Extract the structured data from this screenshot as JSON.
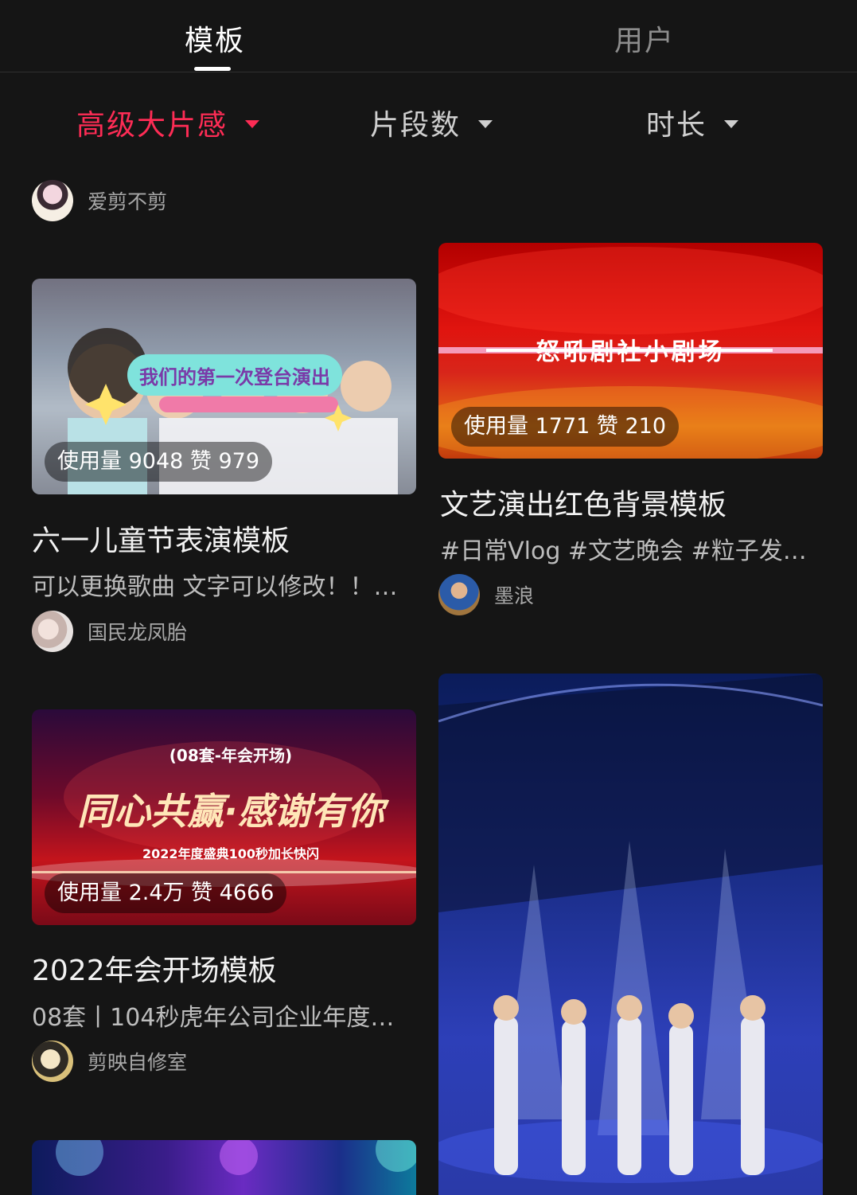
{
  "tabs": [
    {
      "label": "模板",
      "active": true
    },
    {
      "label": "用户",
      "active": false
    }
  ],
  "filters": [
    {
      "label": "高级大片感",
      "active": true
    },
    {
      "label": "片段数",
      "active": false
    },
    {
      "label": "时长",
      "active": false
    }
  ],
  "colors": {
    "accent": "#fe2c55",
    "background": "#151515"
  },
  "cards": [
    {
      "author": "爱剪不剪"
    },
    {
      "author": "墨浪"
    },
    {
      "thumb_caption": "我们的第一次登台演出",
      "stats": "使用量 9048 赞 979",
      "title": "六一儿童节表演模板",
      "description": "可以更换歌曲 文字可以修改！！…",
      "author": "国民龙凤胎"
    },
    {
      "thumb_caption": "怒吼剧社小剧场",
      "stats": "使用量 1771 赞 210",
      "title": "文艺演出红色背景模板",
      "description": "#日常Vlog #文艺晚会 #粒子发…",
      "author": "墨浪"
    },
    {
      "thumb_caption_top": "(08套-年会开场)",
      "thumb_caption": "同心共赢·感谢有你",
      "thumb_caption_sub": "2022年度盛典100秒加长快闪",
      "stats": "使用量 2.4万 赞 4666",
      "title": "2022年会开场模板",
      "description": "08套丨104秒虎年公司企业年度…",
      "author": "剪映自修室"
    },
    {
      "thumb_caption": "",
      "stats": ""
    }
  ]
}
